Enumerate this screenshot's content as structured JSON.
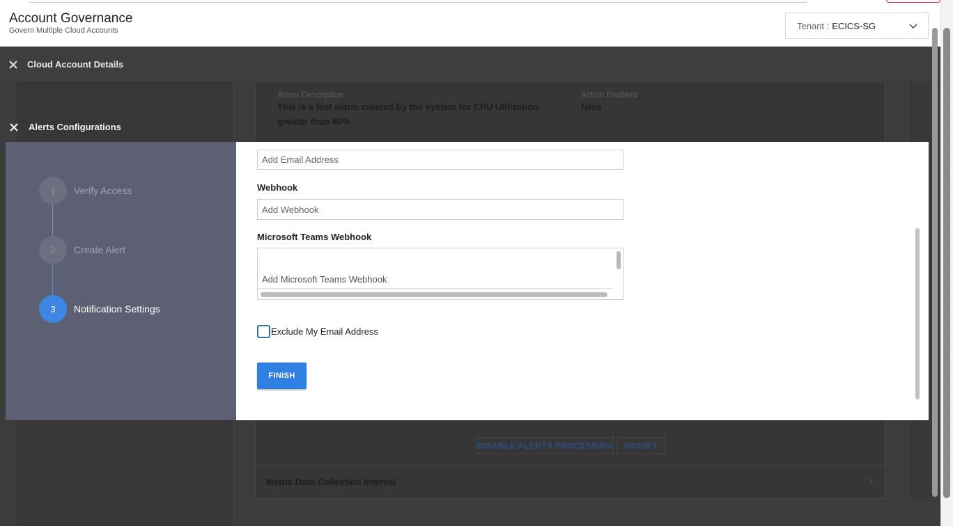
{
  "header": {
    "title": "Account Governance",
    "subtitle": "Govern Multiple Cloud Accounts",
    "tenant_label": "Tenant :",
    "tenant_value": "ECICS-SG"
  },
  "overlays": {
    "cloud_account_title": "Cloud Account Details",
    "alerts_config_title": "Alerts Configurations"
  },
  "background": {
    "alarm_description_label": "Alarm Description",
    "alarm_description_line1": "This is a test alarm created by the system for CPU Utilization",
    "alarm_description_line2": "greater than 80%",
    "action_enabled_label": "Action Enabled",
    "action_enabled_value": "false",
    "disable_alerts_button": "DISABLE ALERTS PROCESSING",
    "modify_button": "MODIFY",
    "metric_row_label": "Metric Data Collection Interval"
  },
  "wizard": {
    "steps": [
      {
        "number": "1",
        "label": "Verify Access"
      },
      {
        "number": "2",
        "label": "Create Alert"
      },
      {
        "number": "3",
        "label": "Notification Settings"
      }
    ],
    "active_step": 3
  },
  "form": {
    "email_placeholder": "Add Email Address",
    "webhook_label": "Webhook",
    "webhook_placeholder": "Add Webhook",
    "teams_label": "Microsoft Teams Webhook",
    "teams_placeholder": "Add Microsoft Teams Webhook",
    "exclude_email_label": "Exclude My Email Address",
    "exclude_email_checked": false,
    "finish_label": "FINISH"
  },
  "colors": {
    "accent": "#2f80e3",
    "wizard_bg": "#5c6072",
    "overlay": "#3c3c3c"
  }
}
